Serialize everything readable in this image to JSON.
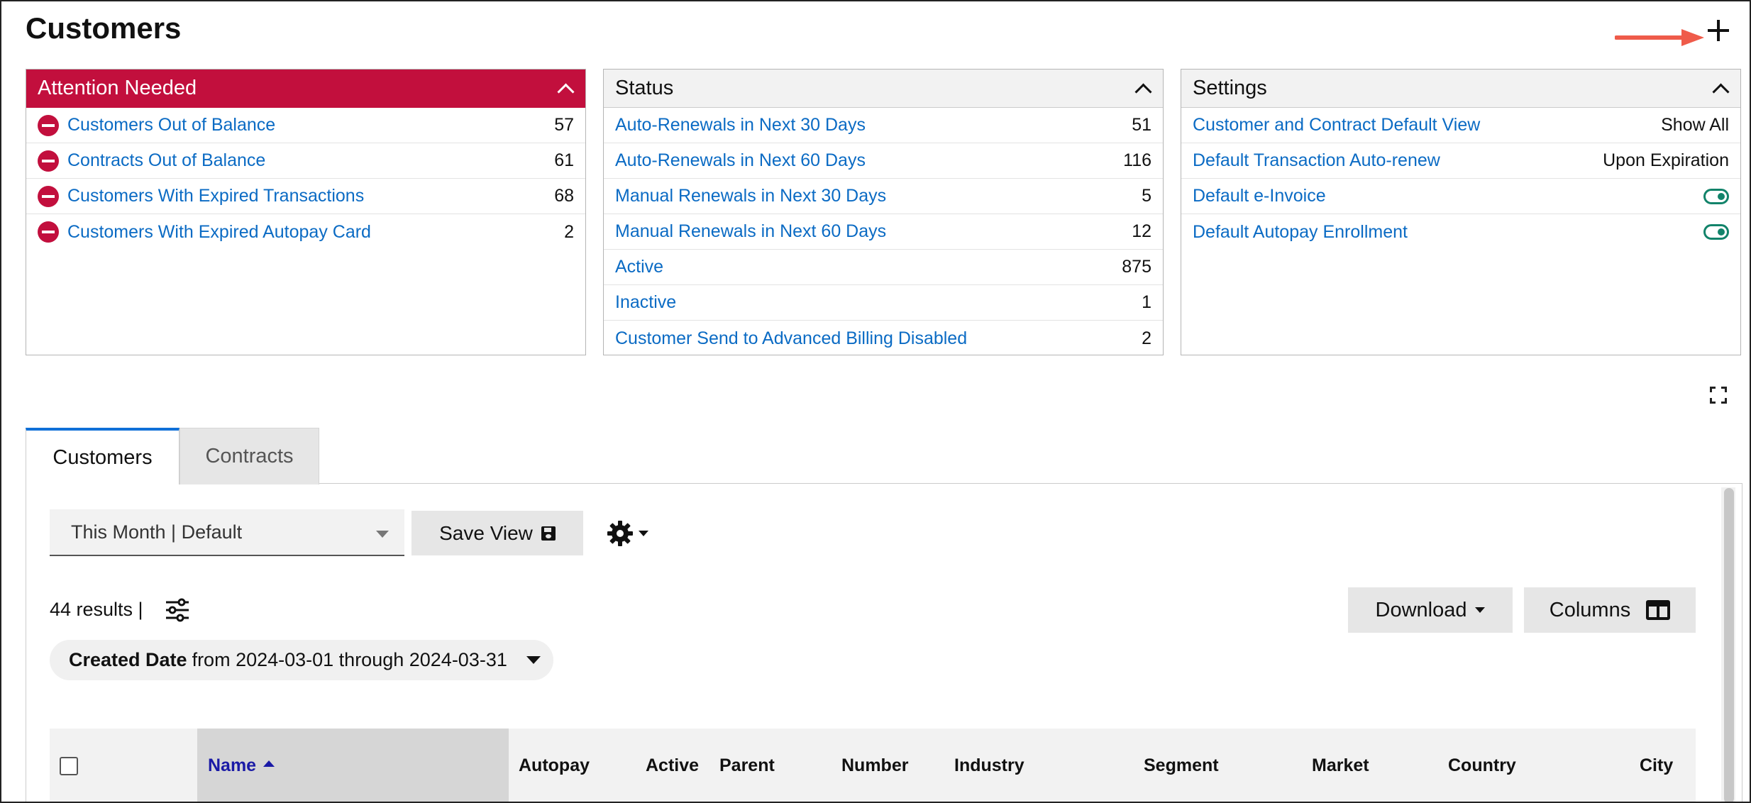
{
  "page": {
    "title": "Customers"
  },
  "attention": {
    "title": "Attention Needed",
    "items": [
      {
        "label": "Customers Out of Balance",
        "count": "57"
      },
      {
        "label": "Contracts Out of Balance",
        "count": "61"
      },
      {
        "label": "Customers With Expired Transactions",
        "count": "68"
      },
      {
        "label": "Customers With Expired Autopay Card",
        "count": "2"
      }
    ]
  },
  "status": {
    "title": "Status",
    "items": [
      {
        "label": "Auto-Renewals in Next 30 Days",
        "count": "51"
      },
      {
        "label": "Auto-Renewals in Next 60 Days",
        "count": "116"
      },
      {
        "label": "Manual Renewals in Next 30 Days",
        "count": "5"
      },
      {
        "label": "Manual Renewals in Next 60 Days",
        "count": "12"
      },
      {
        "label": "Active",
        "count": "875"
      },
      {
        "label": "Inactive",
        "count": "1"
      },
      {
        "label": "Customer Send to Advanced Billing Disabled",
        "count": "2"
      }
    ]
  },
  "settings": {
    "title": "Settings",
    "items": [
      {
        "label": "Customer and Contract Default View",
        "value": "Show All"
      },
      {
        "label": "Default Transaction Auto-renew",
        "value": "Upon Expiration"
      },
      {
        "label": "Default e-Invoice",
        "toggle": true
      },
      {
        "label": "Default Autopay Enrollment",
        "toggle": true
      }
    ]
  },
  "tabs": [
    {
      "label": "Customers",
      "active": true
    },
    {
      "label": "Contracts",
      "active": false
    }
  ],
  "toolbar": {
    "view": "This Month | Default",
    "save_label": "Save View",
    "results": "44 results |",
    "download_label": "Download",
    "columns_label": "Columns"
  },
  "filter_chip": {
    "field": "Created Date",
    "text": "from 2024-03-01 through 2024-03-31"
  },
  "table": {
    "headers": [
      "Name",
      "Autopay",
      "Active",
      "Parent",
      "Number",
      "Industry",
      "Segment",
      "Market",
      "Country",
      "City"
    ],
    "sorted_by": "Name",
    "sort_direction": "ascending"
  },
  "colors": {
    "alert": "#c20f3d",
    "link": "#0b6bc4",
    "toggle": "#12836a",
    "active_tab": "#1070d8",
    "sorted_header_text": "#1a1aa6",
    "callout_arrow": "#ef5b4a"
  },
  "icons": [
    "plus-icon",
    "chevron-up-icon",
    "minus-circle-icon",
    "toggle-on-icon",
    "expand-icon",
    "caret-down-icon",
    "floppy-disk-icon",
    "gear-icon",
    "filter-sliders-icon",
    "columns-icon",
    "sort-asc-icon"
  ]
}
